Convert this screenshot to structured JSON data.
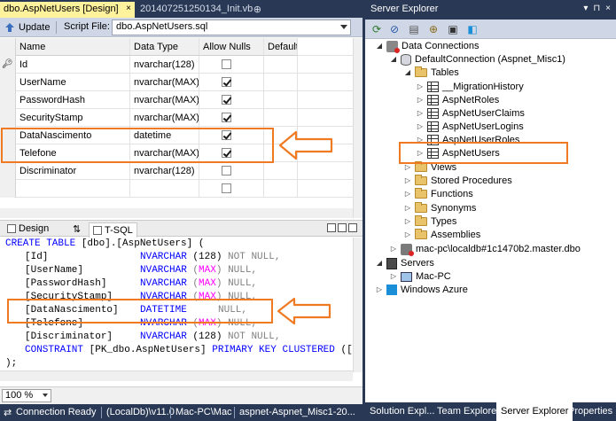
{
  "doc_tabs": [
    {
      "label": "dbo.AspNetUsers [Design]",
      "close": "×"
    },
    {
      "label": "20140725125013​4_Init.vb",
      "pin": "⊕"
    }
  ],
  "toolbar": {
    "update_label": "Update",
    "script_file_label": "Script File:",
    "script_file_value": "dbo.AspNetUsers.sql"
  },
  "grid": {
    "headers": {
      "name": "Name",
      "type": "Data Type",
      "nulls": "Allow Nulls",
      "default": "Default"
    },
    "rows": [
      {
        "name": "Id",
        "type": "nvarchar(128)",
        "allow_nulls": false,
        "key": true
      },
      {
        "name": "UserName",
        "type": "nvarchar(MAX)",
        "allow_nulls": true
      },
      {
        "name": "PasswordHash",
        "type": "nvarchar(MAX)",
        "allow_nulls": true
      },
      {
        "name": "SecurityStamp",
        "type": "nvarchar(MAX)",
        "allow_nulls": true
      },
      {
        "name": "DataNascimento",
        "type": "datetime",
        "allow_nulls": true
      },
      {
        "name": "Telefone",
        "type": "nvarchar(MAX)",
        "allow_nulls": true
      },
      {
        "name": "Discriminator",
        "type": "nvarchar(128)",
        "allow_nulls": false
      },
      {
        "name": "",
        "type": "",
        "allow_nulls": false
      }
    ]
  },
  "pane_tabs": {
    "design": "Design",
    "swap": "⇅",
    "tsql": "T-SQL"
  },
  "sql": {
    "l1a": "CREATE TABLE",
    "l1b": " [dbo].[AspNetUsers] (",
    "c1": "[Id]",
    "c1t": "NVARCHAR",
    "c1p": "(128)",
    "c1n": "NOT NULL,",
    "c2": "[UserName]",
    "c2t": "NVARCHAR",
    "c2p1": "(",
    "c2m": "MAX",
    "c2p2": ")",
    "c2n": "NULL,",
    "c3": "[PasswordHash]",
    "c3t": "NVARCHAR",
    "c3p1": "(",
    "c3m": "MAX",
    "c3p2": ")",
    "c3n": "NULL,",
    "c4": "[SecurityStamp]",
    "c4t": "NVARCHAR",
    "c4p1": "(",
    "c4m": "MAX",
    "c4p2": ")",
    "c4n": "NULL,",
    "c5": "[DataNascimento]",
    "c5t": "DATETIME",
    "c5n": "NULL,",
    "c6": "[Telefone]",
    "c6t": "NVARCHAR",
    "c6p1": "(",
    "c6m": "MAX",
    "c6p2": ")",
    "c6n": "NULL,",
    "c7": "[Discriminator]",
    "c7t": "NVARCHAR",
    "c7p": "(128)",
    "c7n": "NOT NULL,",
    "ck": "CONSTRAINT",
    "ckn": " [PK_dbo.AspNetUsers] ",
    "ckt": "PRIMARY KEY CLUSTERED",
    "cke": " ([",
    "end": ");"
  },
  "zoom": "100 %",
  "status": {
    "ready": "Connection Ready",
    "server": "(LocalDb)\\v11.0",
    "user": "Mac-PC\\Mac",
    "db": "aspnet-Aspnet_Misc1-20..."
  },
  "server_explorer": {
    "title": "Server Explorer",
    "title_controls": [
      "▾",
      "⊓",
      "×"
    ],
    "tree": {
      "data_connections": "Data Connections",
      "default_connection": "DefaultConnection (Aspnet_Misc1)",
      "tables": "Tables",
      "table_items": [
        "__MigrationHistory",
        "AspNetRoles",
        "AspNetUserClaims",
        "AspNetUserLogins",
        "AspNetUserRoles",
        "AspNetUsers"
      ],
      "views": "Views",
      "stored_procedures": "Stored Procedures",
      "functions": "Functions",
      "synonyms": "Synonyms",
      "types": "Types",
      "assemblies": "Assemblies",
      "master_connection": "mac-pc\\localdb#1c1470b2.master.dbo",
      "servers": "Servers",
      "mac_pc": "Mac-PC",
      "azure": "Windows Azure"
    }
  },
  "bottom_tabs": [
    "Solution Expl...",
    "Team Explorer",
    "Server Explorer",
    "Properties"
  ],
  "colors": {
    "highlight": "#f07a21",
    "vs_chrome": "#293955",
    "active_tab": "#fff29d"
  }
}
